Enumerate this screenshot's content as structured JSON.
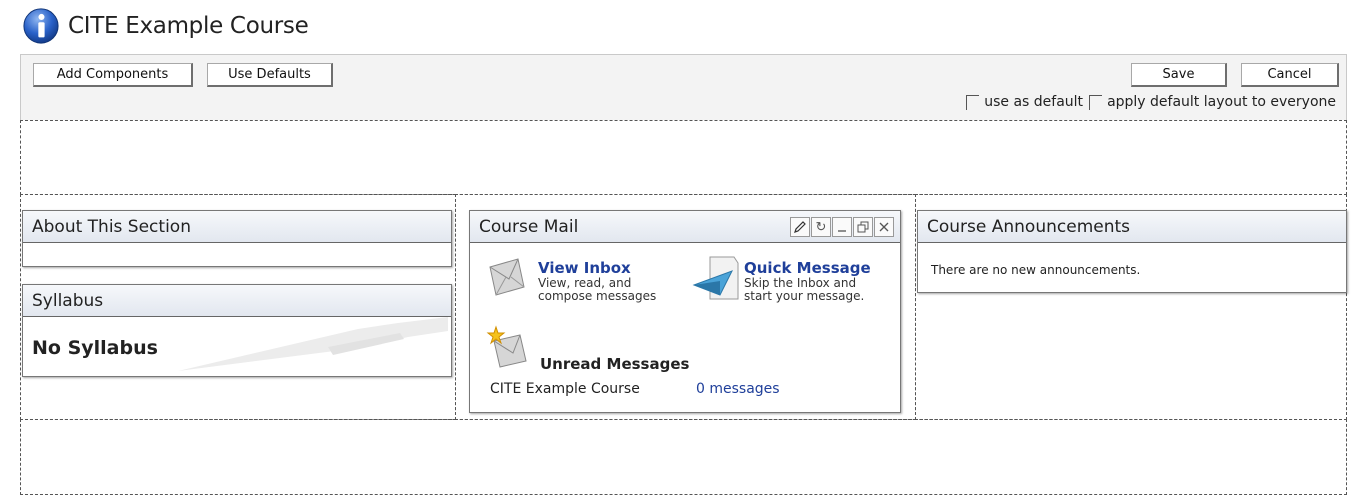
{
  "header": {
    "title": "CITE Example Course",
    "icon": "info-icon"
  },
  "toolbar": {
    "add_components": "Add Components",
    "use_defaults": "Use Defaults",
    "save": "Save",
    "cancel": "Cancel",
    "use_as_default": "use as default",
    "apply_default": "apply default layout to everyone"
  },
  "about": {
    "title": "About This Section"
  },
  "syllabus": {
    "title": "Syllabus",
    "body": "No Syllabus"
  },
  "mail": {
    "title": "Course Mail",
    "view_inbox": "View Inbox",
    "view_inbox_desc_1": "View, read, and",
    "view_inbox_desc_2": "compose messages",
    "quick_message": "Quick Message",
    "quick_message_desc_1": "Skip the Inbox and",
    "quick_message_desc_2": "start your message.",
    "unread_title": "Unread Messages",
    "unread_course": "CITE Example Course",
    "unread_count": "0 messages"
  },
  "announcements": {
    "title": "Course Announcements",
    "body": "There are no new announcements."
  },
  "colors": {
    "link": "#1f3f9a",
    "portlet_header": "#e6ebf2",
    "info_blue": "#2a62c9"
  }
}
